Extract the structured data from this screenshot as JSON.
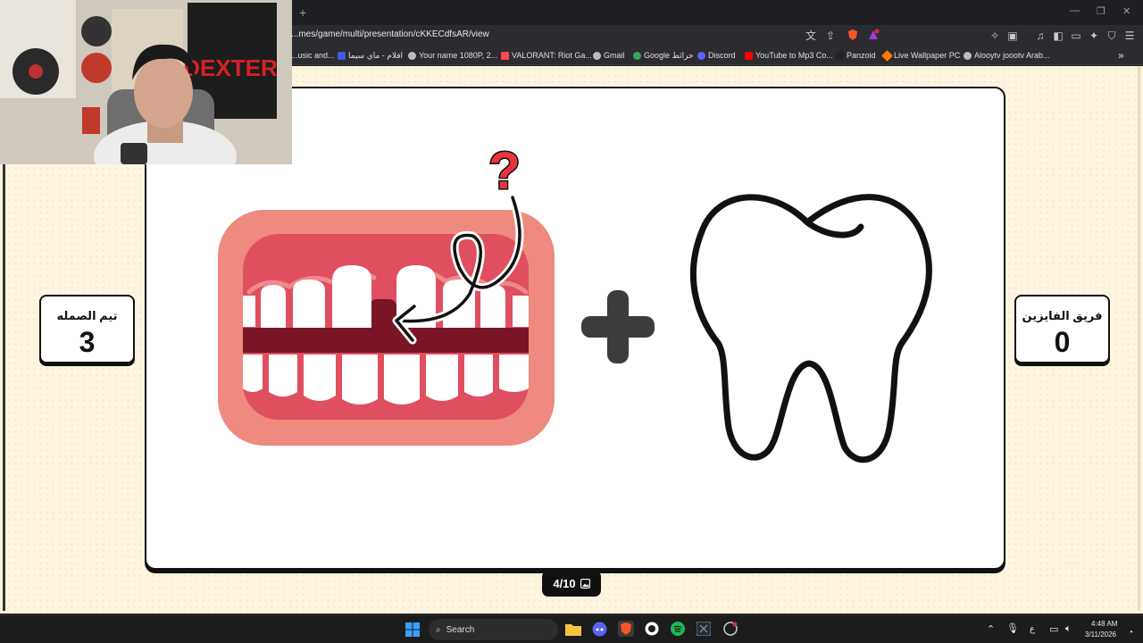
{
  "browser": {
    "new_tab": "+",
    "url": "...mes/game/multi/presentation/cKKECdfsAR/view",
    "bookmarks": [
      {
        "label": "...usic and...",
        "color": "#ff6b6b"
      },
      {
        "label": "افلام - ماي سيما",
        "color": "#3b5bdb"
      },
      {
        "label": "Your name 1080P, 2...",
        "color": "#bbbbbb"
      },
      {
        "label": "VALORANT: Riot Ga...",
        "color": "#ff4655"
      },
      {
        "label": "Gmail",
        "color": "#bbbbbb"
      },
      {
        "label": "Google خرائط",
        "color": "#34a853"
      },
      {
        "label": "Discord",
        "color": "#5865f2"
      },
      {
        "label": "YouTube to Mp3 Co...",
        "color": "#ff0000"
      },
      {
        "label": "Panzoid",
        "color": "#222222"
      },
      {
        "label": "Live Wallpaper PC",
        "color": "#ff7b00"
      },
      {
        "label": "Alooytv joootv Arab...",
        "color": "#bbbbbb"
      }
    ],
    "bookmarks_more": "»"
  },
  "game": {
    "team_left": {
      "name": "تيم الصمله",
      "score": "3"
    },
    "team_right": {
      "name": "فريق الفايزين",
      "score": "0"
    },
    "question_mark": "?",
    "counter": "4/10"
  },
  "taskbar": {
    "search_label": "Search",
    "lang": "ع",
    "time": "4:48 AM",
    "date": "3/11/2026"
  },
  "colors": {
    "page_bg": "#fdf5df",
    "gum_outer": "#ef8a7e",
    "gum_inner": "#e04f5f",
    "dark_gap": "#7a1528"
  }
}
